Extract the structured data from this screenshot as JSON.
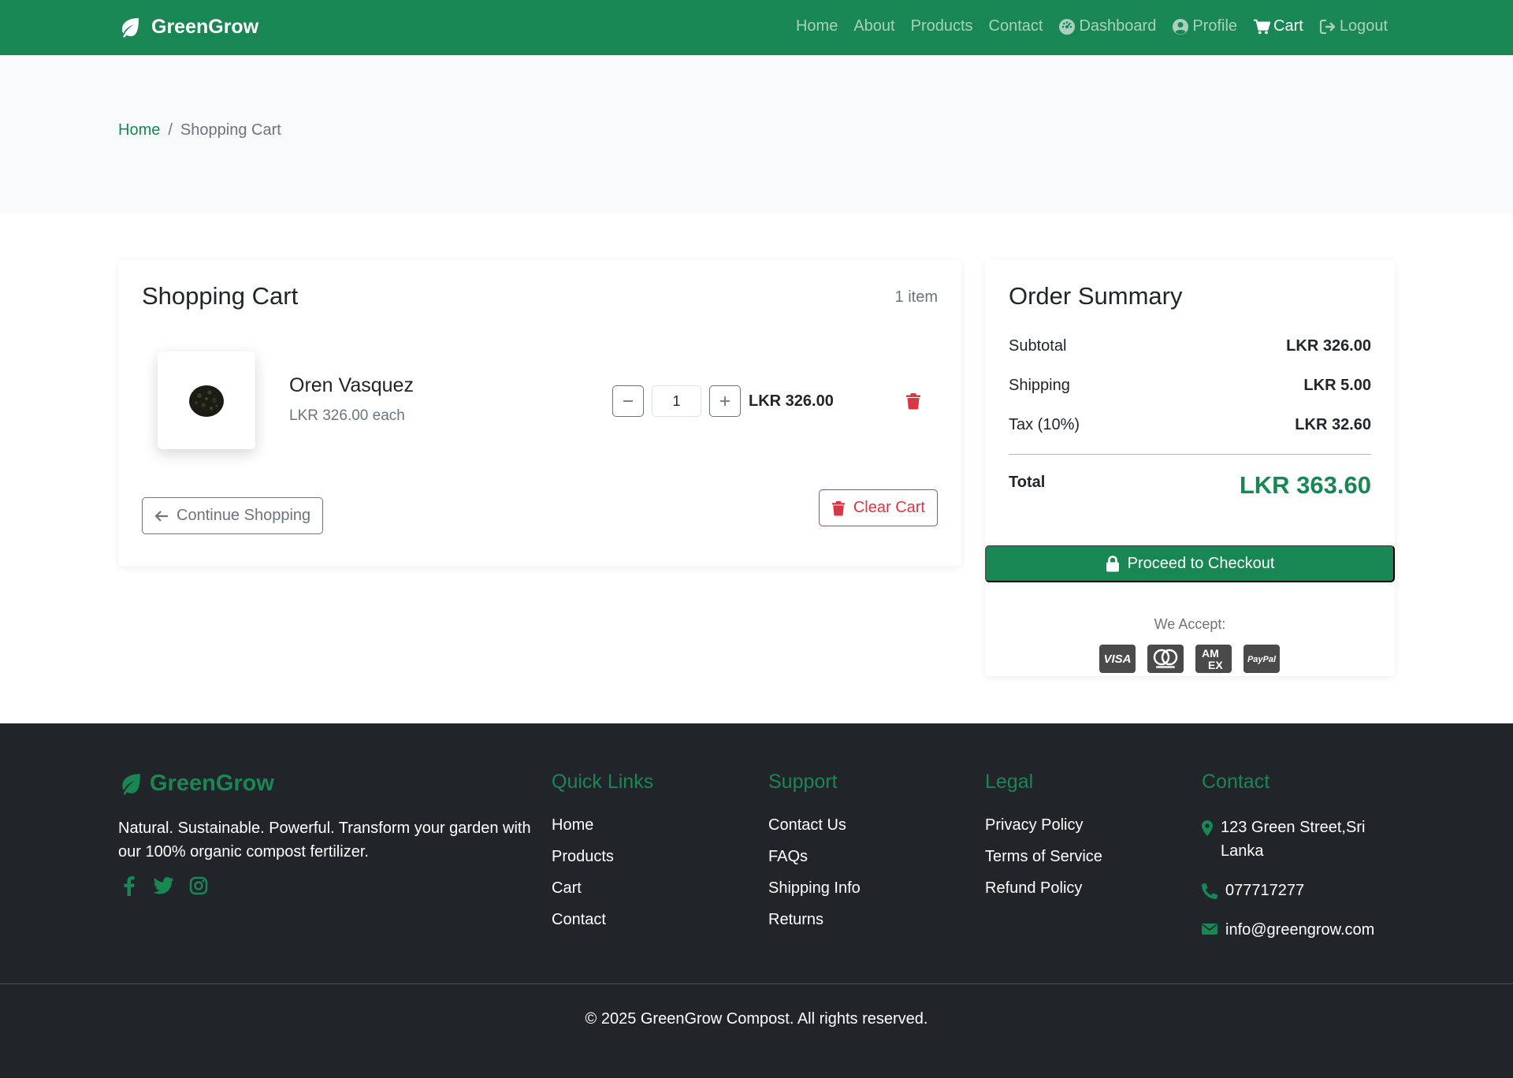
{
  "navbar": {
    "brand": "GreenGrow",
    "links": [
      {
        "label": "Home"
      },
      {
        "label": "About"
      },
      {
        "label": "Products"
      },
      {
        "label": "Contact"
      },
      {
        "label": "Dashboard",
        "icon": "dashboard-icon"
      },
      {
        "label": "Profile",
        "icon": "user-circle-icon"
      },
      {
        "label": "Cart",
        "icon": "cart-icon",
        "active": true
      },
      {
        "label": "Logout",
        "icon": "logout-icon"
      }
    ]
  },
  "breadcrumb": {
    "home": "Home",
    "separator": "/",
    "current": "Shopping Cart"
  },
  "cart": {
    "title": "Shopping Cart",
    "item_count": "1 item",
    "items": [
      {
        "name": "Oren Vasquez",
        "unit_price": "LKR 326.00 each",
        "quantity": "1",
        "line_total": "LKR 326.00",
        "image_icon": "compost-pile-icon"
      }
    ],
    "continue_label": "Continue Shopping",
    "clear_label": "Clear Cart"
  },
  "summary": {
    "title": "Order Summary",
    "rows": [
      {
        "label": "Subtotal",
        "value": "LKR 326.00"
      },
      {
        "label": "Shipping",
        "value": "LKR 5.00"
      },
      {
        "label": "Tax (10%)",
        "value": "LKR 32.60"
      }
    ],
    "total_label": "Total",
    "total_value": "LKR 363.60",
    "checkout_label": "Proceed to Checkout",
    "accept_label": "We Accept:",
    "payment_methods": [
      "visa-icon",
      "mastercard-icon",
      "amex-icon",
      "paypal-icon"
    ]
  },
  "footer": {
    "brand": "GreenGrow",
    "tagline": "Natural. Sustainable. Powerful. Transform your garden with our 100% organic compost fertilizer.",
    "social": [
      "facebook-icon",
      "twitter-icon",
      "instagram-icon"
    ],
    "quick_links": {
      "title": "Quick Links",
      "items": [
        "Home",
        "Products",
        "Cart",
        "Contact"
      ]
    },
    "support": {
      "title": "Support",
      "items": [
        "Contact Us",
        "FAQs",
        "Shipping Info",
        "Returns"
      ]
    },
    "legal": {
      "title": "Legal",
      "items": [
        "Privacy Policy",
        "Terms of Service",
        "Refund Policy"
      ]
    },
    "contact": {
      "title": "Contact",
      "address": "123 Green Street,Sri Lanka",
      "phone": "077717277",
      "email": "info@greengrow.com"
    },
    "copyright": "© 2025 GreenGrow Compost. All rights reserved."
  },
  "colors": {
    "brand": "#198754",
    "danger": "#dc3545",
    "muted": "#6c757d",
    "footer_bg": "#212529",
    "band_bg": "#f8f9fa"
  }
}
